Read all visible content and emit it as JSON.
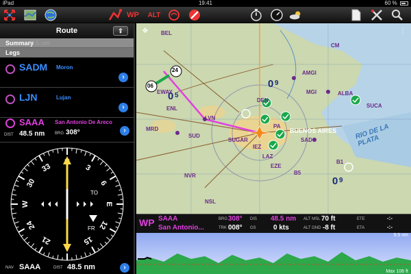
{
  "status_bar": {
    "device": "iPad",
    "time": "19:41",
    "battery": "60 %"
  },
  "toolbar": {
    "left_icons": [
      "expand-icon",
      "map-icon",
      "globe-icon"
    ],
    "center_icons": [
      "flight-plan-icon",
      "wpt-icon",
      "alt-icon",
      "weather-radar-icon",
      "no-entry-icon"
    ],
    "wp_label": "WP",
    "alt_label": "ALT",
    "right_icons": [
      "stopwatch-icon",
      "gauge-icon",
      "weather-icon",
      "document-icon",
      "tools-icon",
      "search-icon"
    ]
  },
  "route": {
    "title": "Route",
    "share_label": "⇪",
    "summary_label": "Summary",
    "summary_value": "48.5 nm",
    "legs_label": "Legs",
    "waypoints": [
      {
        "ident": "SADM",
        "name": "Moron"
      },
      {
        "ident": "LJN",
        "name": "Lujan"
      }
    ],
    "active": {
      "ident": "SAAA",
      "name": "San Antonio De Areco",
      "dist_label": "DIST",
      "dist": "48.5 nm",
      "brg_label": "BRG",
      "brg": "308°"
    }
  },
  "hsi": {
    "labels": [
      "3",
      "6",
      "E",
      "12",
      "15",
      "S",
      "21",
      "24",
      "W",
      "30",
      "33",
      "N"
    ],
    "to_label": "TO",
    "fr_label": "FR"
  },
  "nav": {
    "nav_label": "NAV",
    "ident": "SAAA",
    "dist_label": "DIST",
    "dist": "48.5 nm"
  },
  "map": {
    "labels": [
      "BEL",
      "SUCA",
      "ALBA",
      "AMGI",
      "MGI",
      "DEN",
      "PA",
      "EWAY",
      "ENL",
      "MRD",
      "SUD",
      "LVN",
      "SUGAR",
      "NVR",
      "BUENOS AIRES",
      "SADO",
      "LAZ",
      "IEZ",
      "NSL",
      "EZE",
      "CM",
      "B1",
      "B5"
    ],
    "river_label": "RIO DE LA PLATA",
    "grid_numbers": [
      "0",
      "9",
      "0",
      "5",
      "0",
      "9"
    ],
    "leg_marker_24": "24",
    "leg_marker_06": "06"
  },
  "info": {
    "wp_label": "WP",
    "ident": "SAAA",
    "name": "San Antonio...",
    "brg_label": "BRG",
    "brg": "308°",
    "trk_label": "TRK",
    "trk": "008°",
    "dis_label": "DIS",
    "dis": "48.5 nm",
    "gs_label": "GS",
    "gs": "0 kts",
    "alt_msl_label": "ALT MSL",
    "alt_msl": "70 ft",
    "alt_gnd_label": "ALT GND",
    "alt_gnd": "-8 ft",
    "ete_label": "ETE",
    "eta_label": "ETA",
    "ete": "-:-",
    "eta": "-:-"
  },
  "profile": {
    "max_label": "9.5 nm",
    "min_label": "Max 106 ft"
  },
  "colors": {
    "route_magenta": "#e040e0",
    "link_blue": "#3a8eff",
    "active_leg": "#e040e0",
    "profile_sky": "#bfd0ff",
    "profile_ground": "#2da84a"
  }
}
